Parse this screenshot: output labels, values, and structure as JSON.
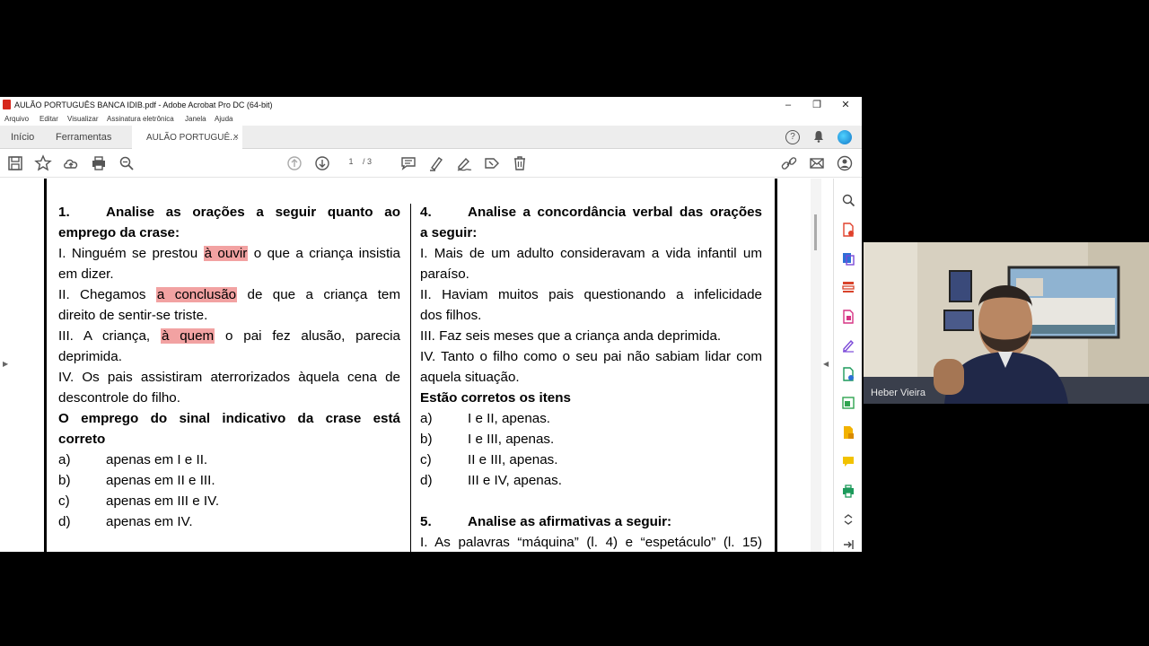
{
  "window": {
    "title": "AULÃO PORTUGUÊS BANCA IDIB.pdf - Adobe Acrobat Pro DC (64-bit)",
    "controls": {
      "minimize": "–",
      "restore": "❐",
      "close": "✕"
    }
  },
  "menu": [
    "Arquivo",
    "Editar",
    "Visualizar",
    "Assinatura eletrônica",
    "Janela",
    "Ajuda"
  ],
  "tabs": {
    "home": "Início",
    "tools": "Ferramentas",
    "document": "AULÃO PORTUGUÊ...",
    "close": "×"
  },
  "toolbar": {
    "page_current": "1",
    "page_total": "/ 3"
  },
  "question1": {
    "number": "1.",
    "title_line1": "Analise as orações a seguir quanto ao",
    "title_line2": "emprego da crase:",
    "i_pre": "I. Ninguém se prestou ",
    "i_hl": "à ouvir",
    "i_post": " o que a criança insistia",
    "i_cont": "em dizer.",
    "ii_pre": "II. Chegamos ",
    "ii_hl": "a conclusão",
    "ii_post": " de que a criança tem",
    "ii_cont": "direito de sentir-se triste.",
    "iii_pre": "III. A criança, ",
    "iii_hl": "à quem",
    "iii_post": " o pai fez alusão, parecia",
    "iii_cont": "deprimida.",
    "iv_line1": "IV. Os pais assistiram aterrorizados àquela cena de",
    "iv_line2": "descontrole do filho.",
    "prompt_line1": "O emprego do sinal indicativo da crase está",
    "prompt_line2": "correto",
    "options": [
      {
        "key": "a)",
        "text": "apenas em I e II."
      },
      {
        "key": "b)",
        "text": "apenas em II e III."
      },
      {
        "key": "c)",
        "text": "apenas em III e IV."
      },
      {
        "key": "d)",
        "text": "apenas em IV."
      }
    ]
  },
  "question4": {
    "number": "4.",
    "title_line1": "Analise a concordância verbal das orações",
    "title_line2": "a seguir:",
    "i_line1": "I. Mais de um adulto consideravam a vida infantil um",
    "i_line2": "paraíso.",
    "ii_line1": "II. Haviam muitos pais questionando a infelicidade",
    "ii_line2": "dos filhos.",
    "iii_line1": "III. Faz seis meses que a criança anda deprimida.",
    "iv_line1": "IV. Tanto o filho como o seu pai não sabiam lidar com",
    "iv_line2": "aquela situação.",
    "prompt": "Estão corretos os itens",
    "options": [
      {
        "key": "a)",
        "text": "I e II, apenas."
      },
      {
        "key": "b)",
        "text": "I e III, apenas."
      },
      {
        "key": "c)",
        "text": "II e III, apenas."
      },
      {
        "key": "d)",
        "text": "III e IV, apenas."
      }
    ]
  },
  "question5": {
    "number": "5.",
    "title": "Analise as afirmativas a seguir:",
    "line1": "I. As palavras “máquina” (l. 4) e “espetáculo” (l. 15)"
  },
  "webcam": {
    "name": "Heber Vieira"
  },
  "colors": {
    "highlight": "#f2a2a2",
    "acrobat_red": "#d7281d",
    "teal_tools": "#2fa44f"
  }
}
